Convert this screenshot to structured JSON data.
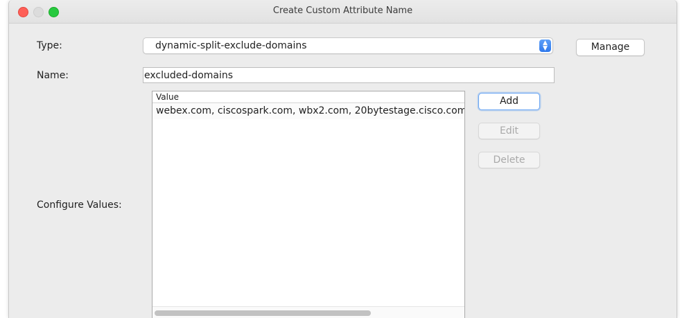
{
  "window": {
    "title": "Create Custom Attribute Name"
  },
  "form": {
    "type_label": "Type:",
    "type_value": "dynamic-split-exclude-domains",
    "manage_label": "Manage",
    "name_label": "Name:",
    "name_value": "excluded-domains",
    "configure_label": "Configure Values:"
  },
  "values_table": {
    "column_header": "Value",
    "rows": [
      "webex.com, ciscospark.com, wbx2.com, 20bytestage.cisco.com"
    ],
    "horizontal_scroll_fraction": 0.69
  },
  "actions": {
    "add_label": "Add",
    "edit_label": "Edit",
    "delete_label": "Delete"
  },
  "colors": {
    "close": "#fe5f57",
    "minimize_inactive": "#dcdcdc",
    "maximize": "#27c93f",
    "accent": "#2e78ec"
  },
  "icons": {
    "select_arrow": "up-down-chevron-icon"
  }
}
